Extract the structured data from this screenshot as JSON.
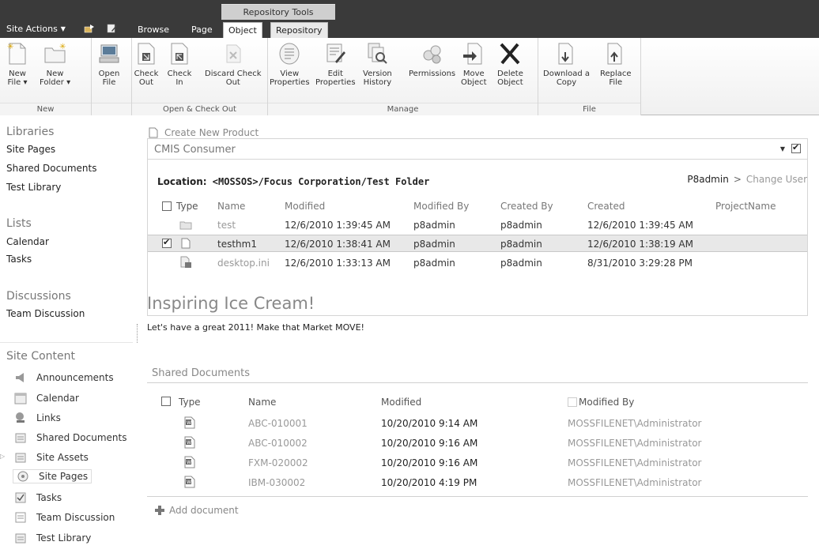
{
  "topbar": {
    "context_label": "Repository Tools",
    "site_actions": "Site Actions",
    "tabs": [
      "Browse",
      "Page",
      "Object",
      "Repository"
    ]
  },
  "ribbon": {
    "groups": {
      "new": "New",
      "checkout": "Open & Check Out",
      "manage": "Manage",
      "file": "File"
    },
    "buttons": {
      "new_file_1": "New",
      "new_file_2": "File",
      "new_folder_1": "New",
      "new_folder_2": "Folder",
      "open_1": "Open",
      "open_2": "File",
      "checkout_1": "Check",
      "checkout_2": "Out",
      "checkin_1": "Check",
      "checkin_2": "In",
      "discard_1": "Discard Check",
      "discard_2": "Out",
      "viewprop_1": "View",
      "viewprop_2": "Properties",
      "editprop_1": "Edit",
      "editprop_2": "Properties",
      "version_1": "Version",
      "version_2": "History",
      "permissions": "Permissions",
      "move_1": "Move",
      "move_2": "Object",
      "delete_1": "Delete",
      "delete_2": "Object",
      "download_1": "Download a",
      "download_2": "Copy",
      "replace_1": "Replace",
      "replace_2": "File"
    }
  },
  "leftnav": {
    "libraries_head": "Libraries",
    "libraries": [
      "Site Pages",
      "Shared Documents",
      "Test Library"
    ],
    "lists_head": "Lists",
    "lists": [
      "Calendar",
      "Tasks"
    ],
    "discussions_head": "Discussions",
    "discussions": [
      "Team Discussion"
    ],
    "site_content_head": "Site Content",
    "site_content": [
      "Announcements",
      "Calendar",
      "Links",
      "Shared Documents",
      "Site Assets",
      "Site Pages",
      "Tasks",
      "Team Discussion",
      "Test Library"
    ]
  },
  "main": {
    "create_new": "Create New Product",
    "cmis_title": "CMIS Consumer",
    "location_label": "Location:",
    "location_value": "<MOSSOS>/Focus Corporation/Test Folder",
    "user": "P8admin",
    "user_sep": ">",
    "change_user": "Change User",
    "cmis_headers": {
      "type": "Type",
      "name": "Name",
      "modified": "Modified",
      "modified_by": "Modified By",
      "created_by": "Created By",
      "created": "Created",
      "project": "ProjectName"
    },
    "cmis_rows": [
      {
        "name": "test",
        "modified": "12/6/2010 1:39:45 AM",
        "modified_by": "p8admin",
        "created_by": "p8admin",
        "created": "12/6/2010 1:39:45 AM"
      },
      {
        "name": "testhm1",
        "modified": "12/6/2010 1:38:41 AM",
        "modified_by": "p8admin",
        "created_by": "p8admin",
        "created": "12/6/2010 1:38:19 AM"
      },
      {
        "name": "desktop.ini",
        "modified": "12/6/2010 1:33:13 AM",
        "modified_by": "p8admin",
        "created_by": "p8admin",
        "created": "8/31/2010 3:29:28 PM"
      }
    ],
    "page_title": "Inspiring Ice Cream!",
    "page_subtitle": "Let's have a great 2011! Make that Market MOVE!",
    "sd_title": "Shared Documents",
    "sd_headers": {
      "type": "Type",
      "name": "Name",
      "modified": "Modified",
      "modified_by": "Modified By"
    },
    "sd_rows": [
      {
        "name": "ABC-010001",
        "modified": "10/20/2010 9:14 AM",
        "modified_by": "MOSSFILENET\\Administrator"
      },
      {
        "name": "ABC-010002",
        "modified": "10/20/2010 9:16 AM",
        "modified_by": "MOSSFILENET\\Administrator"
      },
      {
        "name": "FXM-020002",
        "modified": "10/20/2010 9:16 AM",
        "modified_by": "MOSSFILENET\\Administrator"
      },
      {
        "name": "IBM-030002",
        "modified": "10/20/2010 4:19 PM",
        "modified_by": "MOSSFILENET\\Administrator"
      }
    ],
    "add_document": "Add document"
  }
}
